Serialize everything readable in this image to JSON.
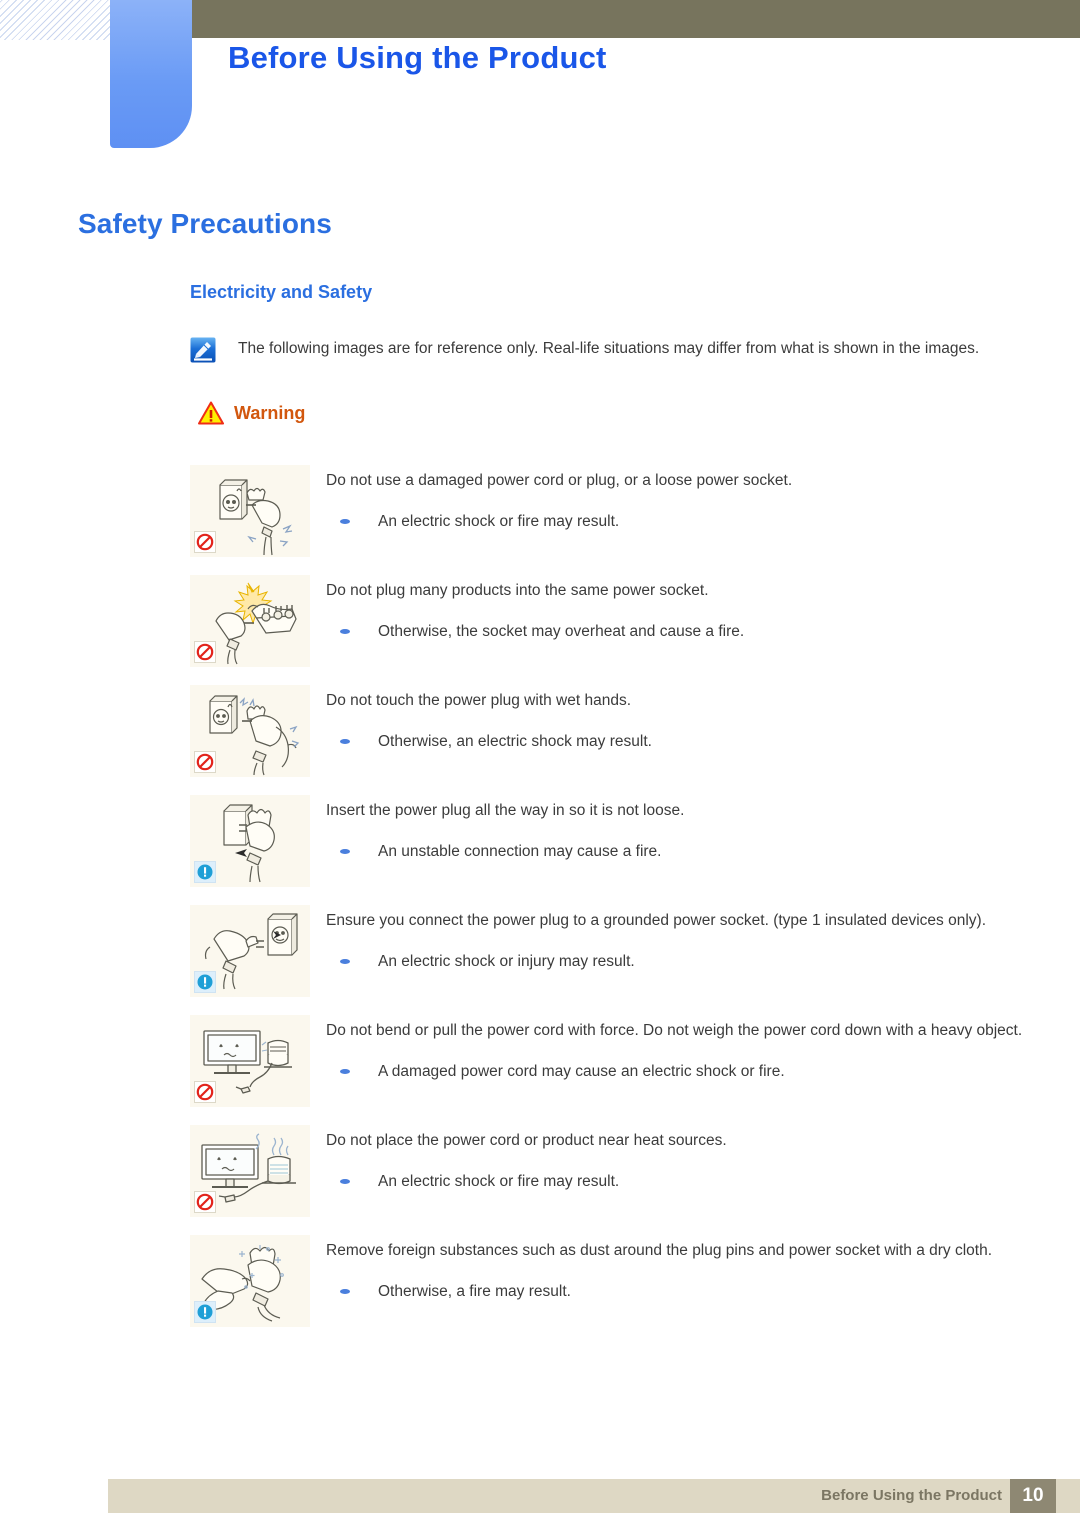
{
  "header": {
    "title": "Before Using the Product",
    "accent_blue": "#1a56e8",
    "band_color": "#77745d",
    "tab_color": "#6a9bf5"
  },
  "chapter_title": "Safety Precautions",
  "section_title": "Electricity and Safety",
  "note": {
    "icon": "note-pen-icon",
    "text": "The following images are for reference only. Real-life situations may differ from what is shown in the images."
  },
  "warning": {
    "icon": "warning-triangle-icon",
    "label": "Warning",
    "color": "#d2570e"
  },
  "advice_items": [
    {
      "figure": "damaged-plug-socket-illustration",
      "badge": "prohibition-icon",
      "badge_type": "no",
      "head": "Do not use a damaged power cord or plug, or a loose power socket.",
      "sub": "An electric shock or fire may result."
    },
    {
      "figure": "overloaded-power-strip-illustration",
      "badge": "prohibition-icon",
      "badge_type": "no",
      "head": "Do not plug many products into the same power socket.",
      "sub": "Otherwise, the socket may overheat and cause a fire."
    },
    {
      "figure": "wet-hands-plug-illustration",
      "badge": "prohibition-icon",
      "badge_type": "no",
      "head": "Do not touch the power plug with wet hands.",
      "sub": "Otherwise, an electric shock may result."
    },
    {
      "figure": "insert-plug-fully-illustration",
      "badge": "mandatory-icon",
      "badge_type": "must",
      "head": "Insert the power plug all the way in so it is not loose.",
      "sub": "An unstable connection may cause a fire."
    },
    {
      "figure": "grounded-socket-illustration",
      "badge": "mandatory-icon",
      "badge_type": "must",
      "head": "Ensure you connect the power plug to a grounded power socket. (type 1 insulated devices only).",
      "sub": "An electric shock or injury may result."
    },
    {
      "figure": "bent-cord-monitor-illustration",
      "badge": "prohibition-icon",
      "badge_type": "no",
      "head": "Do not bend or pull the power cord with force. Do not weigh the power cord down with a heavy object.",
      "sub": "A damaged power cord may cause an electric shock or fire."
    },
    {
      "figure": "heat-source-monitor-illustration",
      "badge": "prohibition-icon",
      "badge_type": "no",
      "head": "Do not place the power cord or product near heat sources.",
      "sub": "An electric shock or fire may result."
    },
    {
      "figure": "clean-plug-cloth-illustration",
      "badge": "mandatory-icon",
      "badge_type": "must",
      "head": "Remove foreign substances such as dust around the plug pins and power socket with a dry cloth.",
      "sub": "Otherwise, a fire may result."
    }
  ],
  "footer": {
    "text": "Before Using the Product",
    "page_number": "10",
    "bar_color": "#ded8c4",
    "page_box_color": "#8e8873"
  }
}
